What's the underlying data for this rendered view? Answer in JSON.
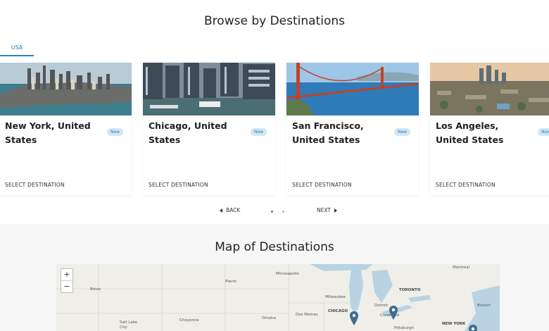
{
  "browse": {
    "title": "Browse by Destinations",
    "tabs": [
      {
        "label": "USA"
      }
    ]
  },
  "cards": [
    {
      "name": "New York, United States",
      "badge": "New",
      "action": "SELECT DESTINATION"
    },
    {
      "name": "Chicago, United States",
      "badge": "New",
      "action": "SELECT DESTINATION"
    },
    {
      "name": "San Francisco, United States",
      "badge": "New",
      "action": "SELECT DESTINATION"
    },
    {
      "name": "Los Angeles, United States",
      "badge": "New",
      "action": "SELECT DESTINATION"
    }
  ],
  "pager": {
    "back": "BACK",
    "next": "NEXT",
    "page_count": 2,
    "active_page": 1
  },
  "map": {
    "title": "Map of Destinations",
    "zoom_in": "+",
    "zoom_out": "−",
    "labels": [
      {
        "text": "Boise"
      },
      {
        "text": "Pierre"
      },
      {
        "text": "Minneapolis"
      },
      {
        "text": "Milwaukee"
      },
      {
        "text": "CHICAGO"
      },
      {
        "text": "Des Moines"
      },
      {
        "text": "Omaha"
      },
      {
        "text": "Cheyenne"
      },
      {
        "text": "Salt Lake City"
      },
      {
        "text": "Detroit"
      },
      {
        "text": "TORONTO"
      },
      {
        "text": "Cleveland"
      },
      {
        "text": "Pittsburgh"
      },
      {
        "text": "NEW YORK"
      },
      {
        "text": "Boston"
      },
      {
        "text": "Montreal"
      }
    ]
  },
  "colors": {
    "accent": "#2a82c4",
    "badge_bg": "#cfe8f7",
    "pin": "#3d6d8c"
  }
}
